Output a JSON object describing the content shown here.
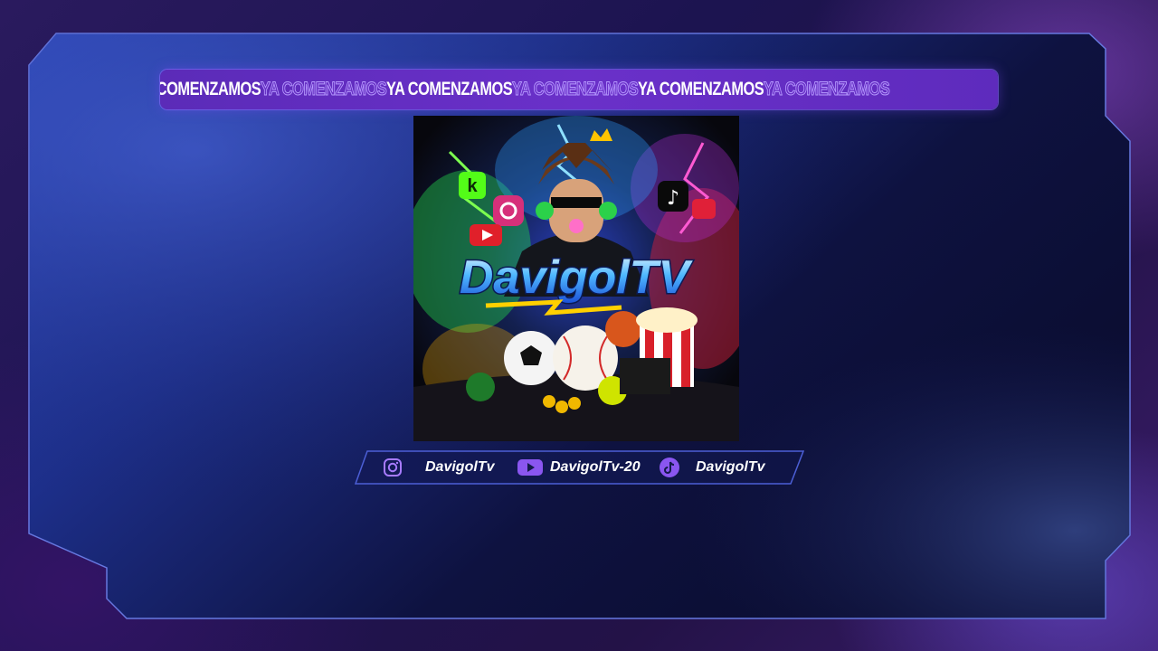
{
  "ticker": {
    "items": [
      {
        "text": "YA COMENZAMOS",
        "style": "solid"
      },
      {
        "text": "YA COMENZAMOS",
        "style": "outline"
      },
      {
        "text": "YA COMENZAMOS",
        "style": "solid"
      },
      {
        "text": "YA COMENZAMOS",
        "style": "outline"
      },
      {
        "text": "YA COMENZAMOS",
        "style": "solid"
      },
      {
        "text": "YA COMENZAMOS",
        "style": "outline"
      }
    ]
  },
  "artwork": {
    "logo_text": "DavigolTV"
  },
  "socials": {
    "instagram": {
      "handle": "DavigolTv",
      "icon": "instagram-icon"
    },
    "youtube": {
      "handle": "DavigolTv-20",
      "icon": "youtube-icon"
    },
    "tiktok": {
      "handle": "DavigolTv",
      "icon": "tiktok-icon"
    }
  },
  "colors": {
    "accent_purple": "#6a30c9",
    "frame_blue": "#2a3ea8",
    "frame_border": "#5a6bd8"
  }
}
